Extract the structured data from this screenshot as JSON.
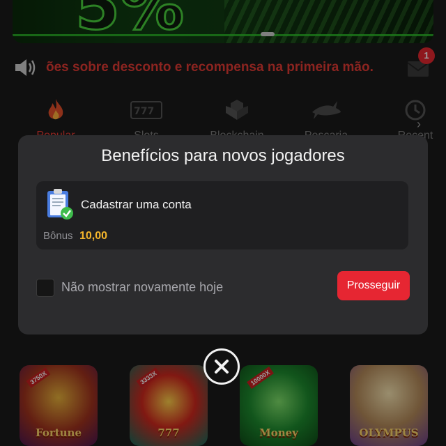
{
  "banner": {
    "promo_text": "5%"
  },
  "announcement": {
    "text": "ões sobre desconto e recompensa na primeira mão.",
    "mail_badge": "1"
  },
  "categories": [
    {
      "label": "Popular",
      "icon": "flame-icon"
    },
    {
      "label": "Slots",
      "icon": "slot-machine-icon"
    },
    {
      "label": "Blockchain",
      "icon": "blockchain-icon"
    },
    {
      "label": "Pescaria",
      "icon": "shark-icon"
    },
    {
      "label": "Recent",
      "icon": "history-icon"
    }
  ],
  "games": [
    {
      "title": "Fortune",
      "badge": "3750X"
    },
    {
      "title": "777",
      "badge": "3333X"
    },
    {
      "title": "Money",
      "badge": "10000X"
    },
    {
      "title": "OLYMPUS",
      "badge": ""
    }
  ],
  "modal": {
    "title": "Benefícios para novos jogadores",
    "task": {
      "label": "Cadastrar uma conta",
      "bonus_label": "Bônus",
      "bonus_value": "10,00"
    },
    "checkbox_label": "Não mostrar novamente hoje",
    "continue_label": "Prosseguir"
  },
  "colors": {
    "accent": "#e62632",
    "bonus": "#f4b52b",
    "modal_bg": "#2c2c2e",
    "card_bg": "#1f1f21"
  }
}
